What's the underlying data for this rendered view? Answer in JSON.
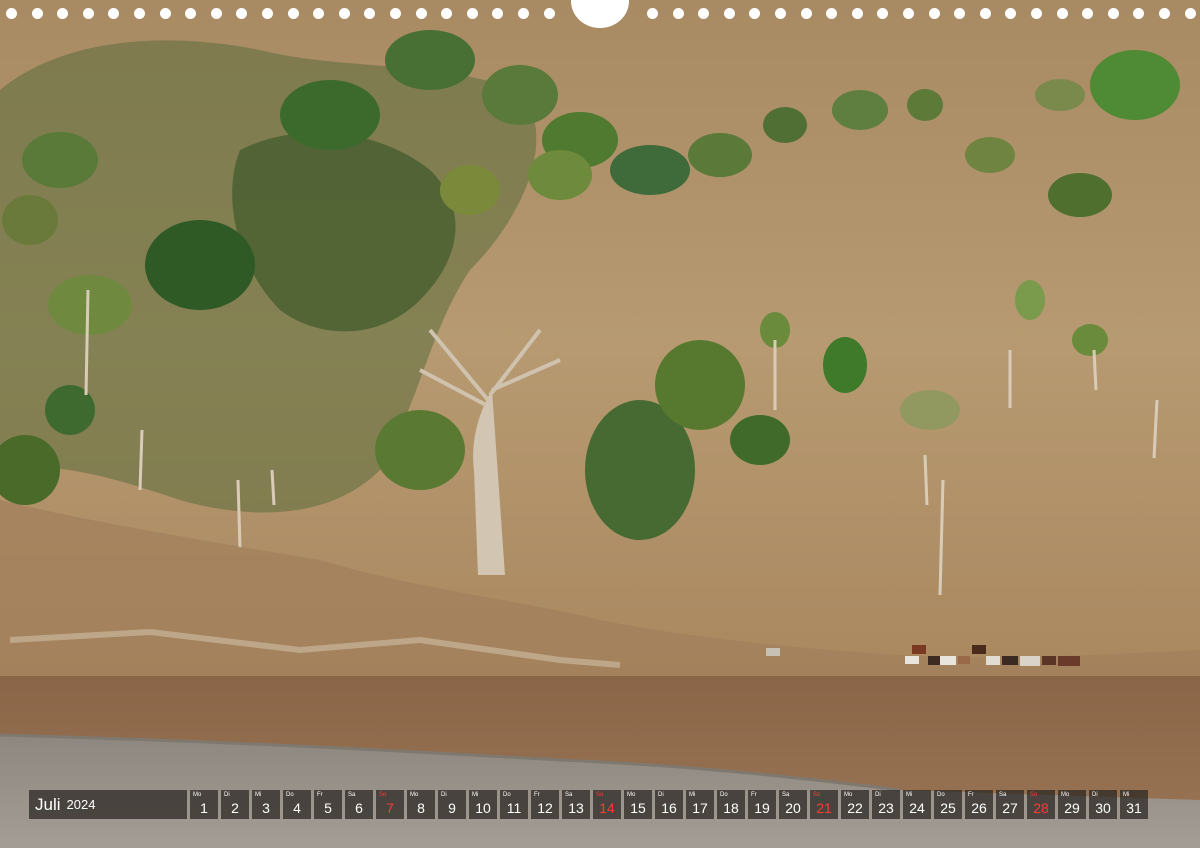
{
  "calendar": {
    "month": "Juli",
    "year": "2024",
    "days": [
      {
        "wd": "Mo",
        "n": "1",
        "sun": false
      },
      {
        "wd": "Di",
        "n": "2",
        "sun": false
      },
      {
        "wd": "Mi",
        "n": "3",
        "sun": false
      },
      {
        "wd": "Do",
        "n": "4",
        "sun": false
      },
      {
        "wd": "Fr",
        "n": "5",
        "sun": false
      },
      {
        "wd": "Sa",
        "n": "6",
        "sun": false
      },
      {
        "wd": "So",
        "n": "7",
        "sun": true
      },
      {
        "wd": "Mo",
        "n": "8",
        "sun": false
      },
      {
        "wd": "Di",
        "n": "9",
        "sun": false
      },
      {
        "wd": "Mi",
        "n": "10",
        "sun": false
      },
      {
        "wd": "Do",
        "n": "11",
        "sun": false
      },
      {
        "wd": "Fr",
        "n": "12",
        "sun": false
      },
      {
        "wd": "Sa",
        "n": "13",
        "sun": false
      },
      {
        "wd": "So",
        "n": "14",
        "sun": true
      },
      {
        "wd": "Mo",
        "n": "15",
        "sun": false
      },
      {
        "wd": "Di",
        "n": "16",
        "sun": false
      },
      {
        "wd": "Mi",
        "n": "17",
        "sun": false
      },
      {
        "wd": "Do",
        "n": "18",
        "sun": false
      },
      {
        "wd": "Fr",
        "n": "19",
        "sun": false
      },
      {
        "wd": "Sa",
        "n": "20",
        "sun": false
      },
      {
        "wd": "So",
        "n": "21",
        "sun": true
      },
      {
        "wd": "Mo",
        "n": "22",
        "sun": false
      },
      {
        "wd": "Di",
        "n": "23",
        "sun": false
      },
      {
        "wd": "Mi",
        "n": "24",
        "sun": false
      },
      {
        "wd": "Do",
        "n": "25",
        "sun": false
      },
      {
        "wd": "Fr",
        "n": "26",
        "sun": false
      },
      {
        "wd": "Sa",
        "n": "27",
        "sun": false
      },
      {
        "wd": "So",
        "n": "28",
        "sun": true
      },
      {
        "wd": "Mo",
        "n": "29",
        "sun": false
      },
      {
        "wd": "Di",
        "n": "30",
        "sun": false
      },
      {
        "wd": "Mi",
        "n": "31",
        "sun": false
      }
    ]
  },
  "colors": {
    "hillside": "#b4946a",
    "vegetation": "#4e6b34",
    "river": "#8e6a4b",
    "gravel": "#9a938a",
    "sky": "#2f80ea",
    "sunday": "#ff3a32"
  }
}
